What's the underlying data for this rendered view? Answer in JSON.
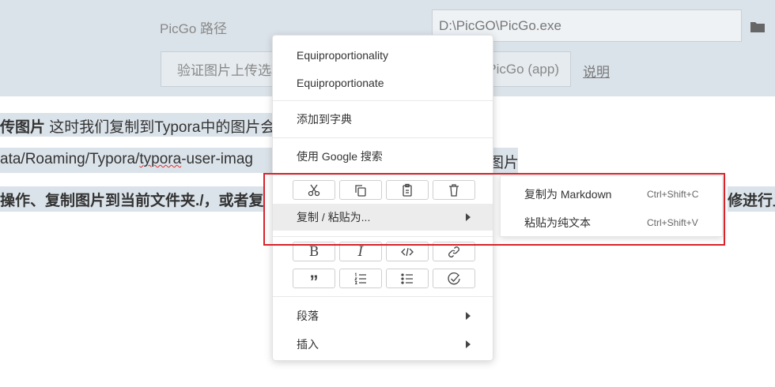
{
  "settings": {
    "picgo_path_label": "PicGo 路径",
    "picgo_path_value": "D:\\PicGO\\PicGo.exe",
    "verify_button": "验证图片上传选项",
    "picgo_app_button": "PicGo (app)",
    "explain_link": "说明"
  },
  "document": {
    "line1_bold": "传图片",
    "line1_text": " 这时我们复制到Typora中的图片会",
    "line2_prefix": "ata/Roaming/Typora/",
    "line2_squiggle": "typora",
    "line2_suffix": "-user-imag",
    "line2_right": "图片",
    "line3_text": "操作、复制图片到当前文件夹./，或者复",
    "line3_right": "修进行上"
  },
  "context_menu": {
    "spell_suggestions": [
      "Equiproportionality",
      "Equiproportionate"
    ],
    "add_to_dictionary": "添加到字典",
    "google_search": "使用 Google 搜索",
    "copy_paste_as": "复制 / 粘贴为...",
    "paragraph": "段落",
    "insert": "插入",
    "edit_icons": [
      "scissors-icon",
      "copy-icon",
      "paste-icon",
      "delete-icon"
    ],
    "format_icons": [
      "bold-icon",
      "italic-icon",
      "code-icon",
      "link-icon",
      "quote-icon",
      "ordered-list-icon",
      "bullet-list-icon",
      "task-list-icon"
    ],
    "bold_glyph": "B",
    "italic_glyph": "I"
  },
  "submenu": {
    "items": [
      {
        "label": "复制为 Markdown",
        "shortcut": "Ctrl+Shift+C"
      },
      {
        "label": "粘贴为纯文本",
        "shortcut": "Ctrl+Shift+V"
      }
    ]
  },
  "colors": {
    "panel_bg": "#dbe3ea",
    "highlight_border": "#d9222a",
    "menu_hover": "#ececec"
  }
}
